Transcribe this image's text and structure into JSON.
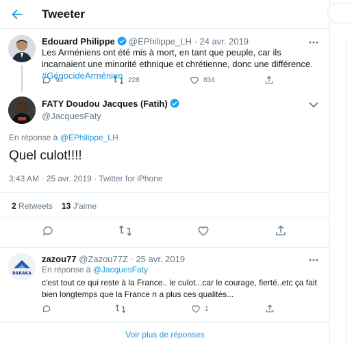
{
  "header": {
    "title": "Tweeter"
  },
  "tweet1": {
    "name": "Edouard Philippe",
    "handle": "@EPhilippe_LH",
    "separator": "·",
    "date": "24 avr. 2019",
    "text": "Les Arméniens ont été mis à mort, en tant que peuple, car ils incarnaient une minorité ethnique et chrétienne, donc une différence.",
    "hashtag": "#GénocideArménien",
    "replies": "94",
    "retweets": "228",
    "likes": "834"
  },
  "tweet2": {
    "name": "FATY Doudou Jacques (Fatih)",
    "handle": "@JacquesFaty",
    "reply_prefix": "En réponse à",
    "reply_handle": "@EPhilippe_LH",
    "text": "Quel culot!!!!",
    "meta": "3:43 AM · 25 avr. 2019 · Twitter for iPhone",
    "retweets_count": "2",
    "retweets_label": "Retweets",
    "likes_count": "13",
    "likes_label": "J'aime"
  },
  "tweet3": {
    "name": "zazou77",
    "handle": "@Zazou77Z",
    "separator": "·",
    "date": "25 avr. 2019",
    "reply_prefix": "En réponse à",
    "reply_handle": "@JacquesFaty",
    "text": "c'est tout ce qui reste à la France.. le culot...car le courage, fierté..etc ça fait bien longtemps que la France n a plus ces qualités...",
    "likes": "1",
    "avatar_text": "BARAKA"
  },
  "more_replies": "Voir plus de réponses",
  "colors": {
    "accent": "#1b95e0",
    "muted": "#657786",
    "border": "#e6ecf0"
  }
}
